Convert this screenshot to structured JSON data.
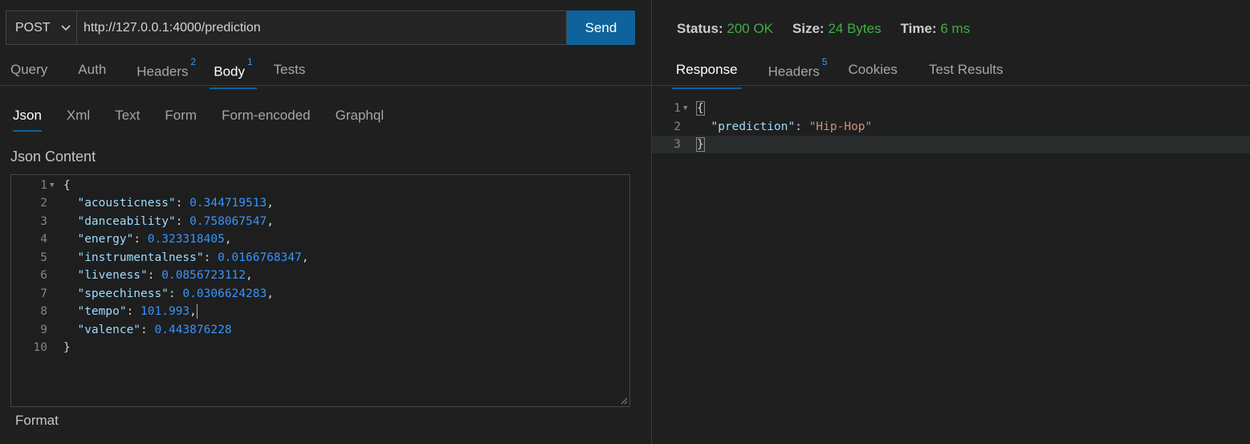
{
  "request": {
    "method": "POST",
    "url": "http://127.0.0.1:4000/prediction",
    "send_label": "Send",
    "tabs": [
      {
        "label": "Query",
        "badge": ""
      },
      {
        "label": "Auth",
        "badge": ""
      },
      {
        "label": "Headers",
        "badge": "2"
      },
      {
        "label": "Body",
        "badge": "1"
      },
      {
        "label": "Tests",
        "badge": ""
      }
    ],
    "active_tab": "Body",
    "body_tabs": [
      "Json",
      "Xml",
      "Text",
      "Form",
      "Form-encoded",
      "Graphql"
    ],
    "active_body_tab": "Json",
    "json_label": "Json Content",
    "format_label": "Format",
    "json_lines": [
      {
        "num": "1",
        "open": "{"
      },
      {
        "num": "2",
        "key": "\"acousticness\"",
        "value": "0.344719513",
        "comma": ","
      },
      {
        "num": "3",
        "key": "\"danceability\"",
        "value": "0.758067547",
        "comma": ","
      },
      {
        "num": "4",
        "key": "\"energy\"",
        "value": "0.323318405",
        "comma": ","
      },
      {
        "num": "5",
        "key": "\"instrumentalness\"",
        "value": "0.0166768347",
        "comma": ","
      },
      {
        "num": "6",
        "key": "\"liveness\"",
        "value": "0.0856723112",
        "comma": ","
      },
      {
        "num": "7",
        "key": "\"speechiness\"",
        "value": "0.0306624283",
        "comma": ","
      },
      {
        "num": "8",
        "key": "\"tempo\"",
        "value": "101.993",
        "comma": ","
      },
      {
        "num": "9",
        "key": "\"valence\"",
        "value": "0.443876228",
        "comma": ""
      },
      {
        "num": "10",
        "close": "}"
      }
    ]
  },
  "response": {
    "status_label": "Status:",
    "status_value": "200 OK",
    "size_label": "Size:",
    "size_value": "24 Bytes",
    "time_label": "Time:",
    "time_value": "6 ms",
    "tabs": [
      {
        "label": "Response",
        "badge": ""
      },
      {
        "label": "Headers",
        "badge": "5"
      },
      {
        "label": "Cookies",
        "badge": ""
      },
      {
        "label": "Test Results",
        "badge": ""
      }
    ],
    "active_tab": "Response",
    "lines": [
      {
        "num": "1",
        "text": "{"
      },
      {
        "num": "2",
        "key": "\"prediction\"",
        "value": "\"Hip-Hop\""
      },
      {
        "num": "3",
        "text": "}"
      }
    ]
  },
  "colors": {
    "accent": "#0e639c",
    "success": "#3cb043",
    "badge": "#3794ff"
  }
}
